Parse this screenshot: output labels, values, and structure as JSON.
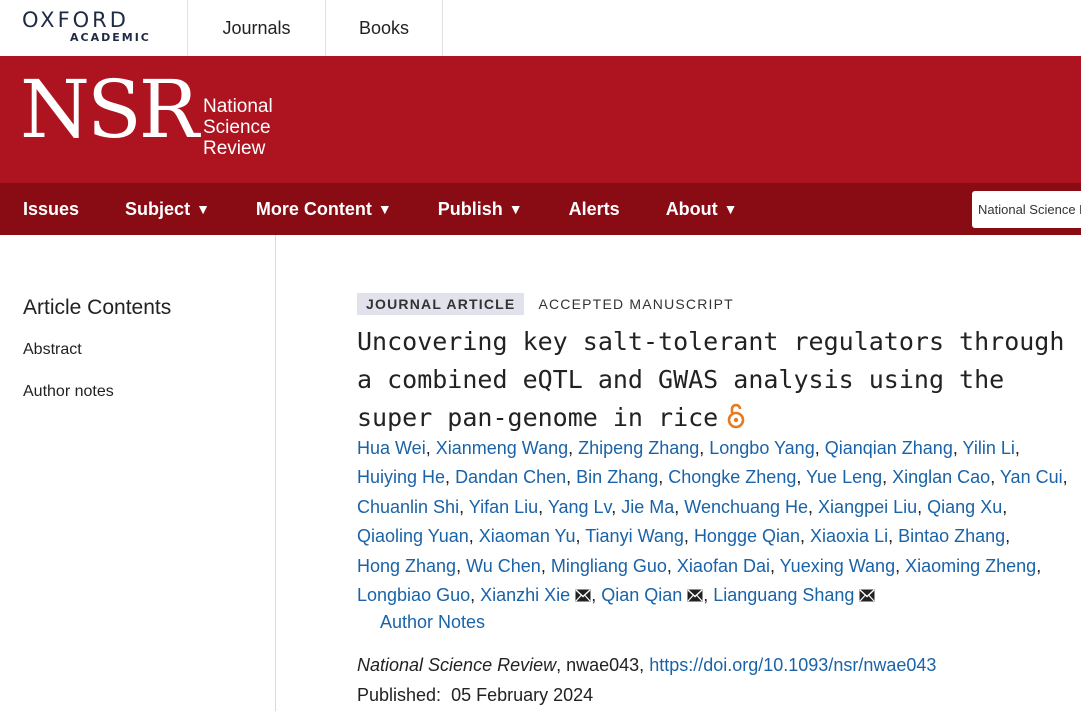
{
  "top_bar": {
    "logo_line1": "OXFORD",
    "logo_line2": "ACADEMIC",
    "links": [
      "Journals",
      "Books"
    ]
  },
  "banner": {
    "logo": "NSR",
    "name_lines": [
      "National",
      "Science",
      "Review"
    ],
    "bg_color": "#ad1420"
  },
  "nav": {
    "items": [
      {
        "label": "Issues",
        "caret": false
      },
      {
        "label": "Subject",
        "caret": true
      },
      {
        "label": "More Content",
        "caret": true
      },
      {
        "label": "Publish",
        "caret": true
      },
      {
        "label": "Alerts",
        "caret": false
      },
      {
        "label": "About",
        "caret": true
      }
    ],
    "caret_glyph": "▼",
    "search_scope": "National Science R",
    "bg_color": "#890b14"
  },
  "sidebar": {
    "title": "Article Contents",
    "items": [
      "Abstract",
      "Author notes"
    ]
  },
  "article": {
    "type_tag": "JOURNAL ARTICLE",
    "status_tag": "ACCEPTED MANUSCRIPT",
    "title": "Uncovering key salt-tolerant regulators through a combined eQTL and GWAS analysis using the super pan-genome in rice",
    "open_access_icon": "open-access-icon",
    "authors": [
      {
        "name": "Hua Wei",
        "mail": false
      },
      {
        "name": "Xianmeng Wang",
        "mail": false
      },
      {
        "name": "Zhipeng Zhang",
        "mail": false
      },
      {
        "name": "Longbo Yang",
        "mail": false
      },
      {
        "name": "Qianqian Zhang",
        "mail": false
      },
      {
        "name": "Yilin Li",
        "mail": false
      },
      {
        "name": "Huiying He",
        "mail": false
      },
      {
        "name": "Dandan Chen",
        "mail": false
      },
      {
        "name": "Bin Zhang",
        "mail": false
      },
      {
        "name": "Chongke Zheng",
        "mail": false
      },
      {
        "name": "Yue Leng",
        "mail": false
      },
      {
        "name": "Xinglan Cao",
        "mail": false
      },
      {
        "name": "Yan Cui",
        "mail": false
      },
      {
        "name": "Chuanlin Shi",
        "mail": false
      },
      {
        "name": "Yifan Liu",
        "mail": false
      },
      {
        "name": "Yang Lv",
        "mail": false
      },
      {
        "name": "Jie Ma",
        "mail": false
      },
      {
        "name": "Wenchuang He",
        "mail": false
      },
      {
        "name": "Xiangpei Liu",
        "mail": false
      },
      {
        "name": "Qiang Xu",
        "mail": false
      },
      {
        "name": "Qiaoling Yuan",
        "mail": false
      },
      {
        "name": "Xiaoman Yu",
        "mail": false
      },
      {
        "name": "Tianyi Wang",
        "mail": false
      },
      {
        "name": "Hongge Qian",
        "mail": false
      },
      {
        "name": "Xiaoxia Li",
        "mail": false
      },
      {
        "name": "Bintao Zhang",
        "mail": false
      },
      {
        "name": "Hong Zhang",
        "mail": false
      },
      {
        "name": "Wu Chen",
        "mail": false
      },
      {
        "name": "Mingliang Guo",
        "mail": false
      },
      {
        "name": "Xiaofan Dai",
        "mail": false
      },
      {
        "name": "Yuexing Wang",
        "mail": false
      },
      {
        "name": "Xiaoming Zheng",
        "mail": false
      },
      {
        "name": "Longbiao Guo",
        "mail": false
      },
      {
        "name": "Xianzhi Xie",
        "mail": true
      },
      {
        "name": "Qian Qian",
        "mail": true
      },
      {
        "name": "Lianguang Shang",
        "mail": true
      }
    ],
    "author_line_breaks_after": [
      5,
      12,
      19,
      25,
      31
    ],
    "author_notes_label": "Author Notes",
    "journal": "National Science Review",
    "article_id": ", nwae043, ",
    "doi": "https://doi.org/10.1093/nsr/nwae043",
    "published_label": "Published:",
    "published_date": "05 February 2024",
    "link_color": "#1a63a8"
  }
}
